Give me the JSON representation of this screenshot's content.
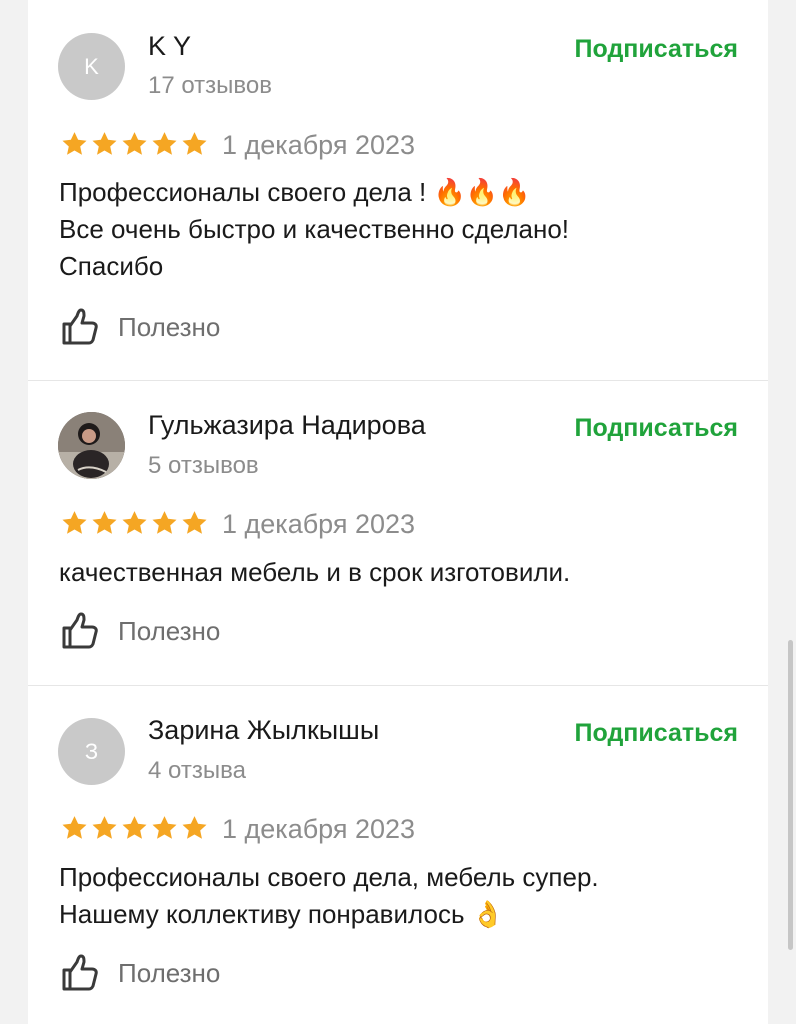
{
  "reviews": [
    {
      "avatar_letter": "K",
      "author": "K Y",
      "count": "17 отзывов",
      "subscribe": "Подписаться",
      "rating": 5,
      "date": "1 декабря 2023",
      "text_lines": [
        "Профессионалы своего дела ! 🔥🔥🔥",
        "Все очень быстро и качественно сделано!",
        "Спасибо"
      ],
      "helpful": "Полезно"
    },
    {
      "avatar_letter": "",
      "author": "Гульжазира Надирова",
      "count": "5 отзывов",
      "subscribe": "Подписаться",
      "rating": 5,
      "date": "1 декабря 2023",
      "text_lines": [
        "качественная мебель и в срок изготовили."
      ],
      "helpful": "Полезно"
    },
    {
      "avatar_letter": "З",
      "author": "Зарина Жылкышы",
      "count": "4 отзыва",
      "subscribe": "Подписаться",
      "rating": 5,
      "date": "1 декабря 2023",
      "text_lines": [
        "Профессионалы своего дела, мебель супер.",
        "Нашему коллективу понравилось 👌"
      ],
      "helpful": "Полезно"
    }
  ],
  "colors": {
    "accent_green": "#20a33b",
    "star": "#f5a623",
    "muted": "#8c8c8c"
  },
  "icons": {
    "star": "star-icon",
    "like": "thumbs-up-icon"
  }
}
